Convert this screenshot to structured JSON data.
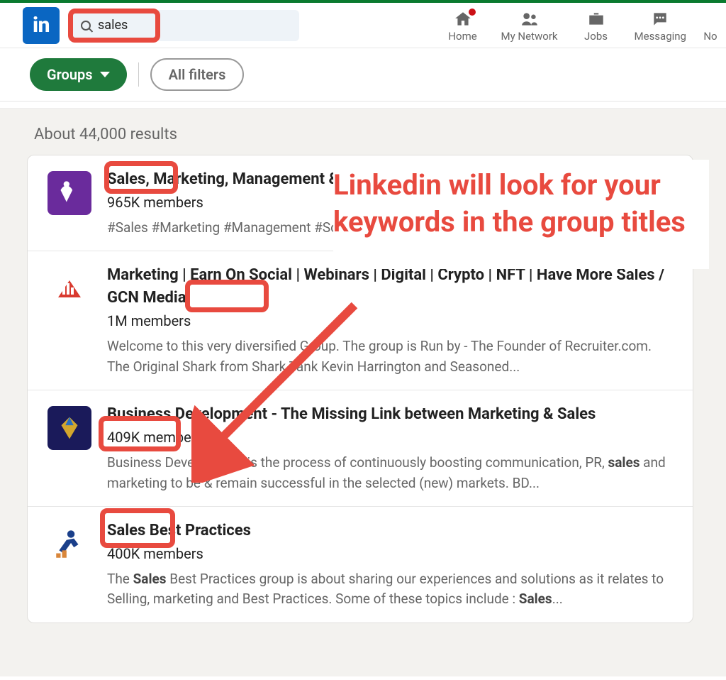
{
  "brand": "in",
  "search": {
    "value": "sales"
  },
  "nav": {
    "home": "Home",
    "network": "My Network",
    "jobs": "Jobs",
    "messaging": "Messaging",
    "notifications": "No"
  },
  "filters": {
    "groups": "Groups",
    "all": "All filters"
  },
  "results_count": "About 44,000 results",
  "annotation": "Linkedin will look for your keywords in the group titles",
  "groups": [
    {
      "title": "Sales, Marketing, Management & Innovation by TheSolutionPe",
      "members": "965K members",
      "desc": "#Sales #Marketing #Management #So #DigitalMarketing #Technology #Entre"
    },
    {
      "title": "Marketing | Earn On Social | Webinars | Digital | Crypto | NFT | Have More Sales / GCN Media",
      "members": "1M members",
      "desc": "Welcome to this very diversified Group. The group is Run by - The Founder of Recruiter.com. The Original Shark from Shark Tank Kevin Harrington and Seasoned..."
    },
    {
      "title": "Business Development - The Missing Link between Marketing & Sales",
      "members": "409K members",
      "desc_pre": "Business Development is the process of continuously boosting communication, PR, ",
      "desc_bold": "sales",
      "desc_post": " and marketing to be & remain successful in the selected (new) markets. BD..."
    },
    {
      "title": "Sales Best Practices",
      "members": "400K members",
      "desc_pre": "The ",
      "desc_b1": "Sales",
      "desc_mid": " Best Practices group is about sharing our experiences and solutions as it relates to Selling, marketing and Best Practices. Some of these topics include : ",
      "desc_b2": "Sales",
      "desc_post": "..."
    }
  ]
}
